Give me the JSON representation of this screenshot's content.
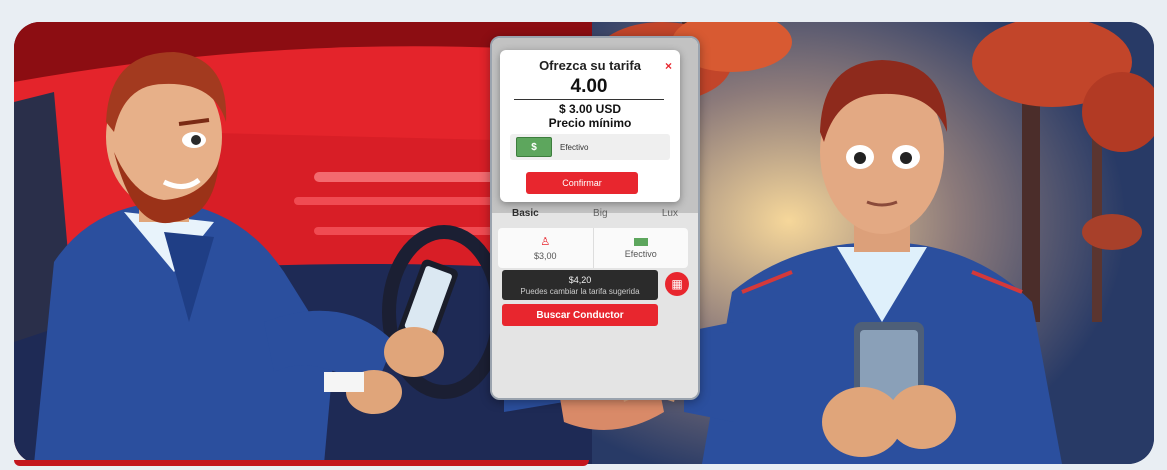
{
  "modal": {
    "title": "Ofrezca su tarifa",
    "close_symbol": "×",
    "amount": "4.00",
    "min_price_value": "$ 3.00 USD",
    "min_price_label": "Precio mínimo",
    "payment_label": "Efectivo",
    "confirm_label": "Confirmar",
    "cash_symbol": "$"
  },
  "app": {
    "ride_options": [
      "Basic",
      "Big",
      "Lux"
    ],
    "fare_value": "$3,00",
    "payment_label": "Efectivo",
    "suggested_fare": "$4,20",
    "suggested_hint": "Puedes cambiar la tarifa sugerida",
    "search_driver_label": "Buscar Conductor"
  },
  "colors": {
    "accent_red": "#e8262e",
    "cash_green": "#5da65d",
    "suit_blue": "#2b4f9e"
  },
  "icons": [
    "close-icon",
    "cash-icon",
    "user-icon",
    "calendar-icon"
  ]
}
